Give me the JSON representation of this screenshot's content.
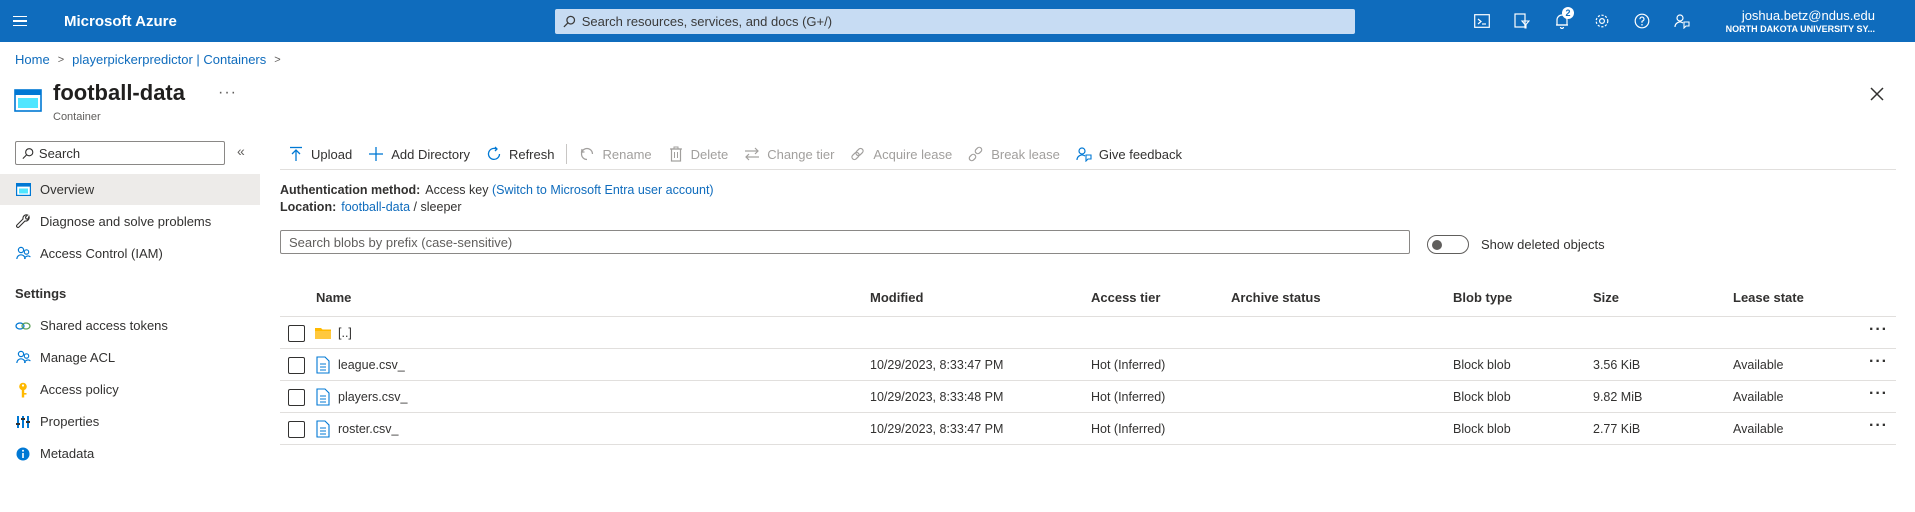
{
  "topbar": {
    "brand": "Microsoft Azure",
    "search_placeholder": "Search resources, services, and docs (G+/)",
    "notification_count": "2",
    "account_email": "joshua.betz@ndus.edu",
    "account_org": "NORTH DAKOTA UNIVERSITY SY..."
  },
  "breadcrumb": {
    "home": "Home",
    "parent": "playerpickerpredictor | Containers"
  },
  "header": {
    "title": "football-data",
    "subtitle": "Container",
    "more": "···"
  },
  "sidebar": {
    "search_placeholder": "Search",
    "collapse": "«",
    "items": [
      {
        "label": "Overview",
        "icon": "overview-icon"
      },
      {
        "label": "Diagnose and solve problems",
        "icon": "wrench-icon"
      },
      {
        "label": "Access Control (IAM)",
        "icon": "people-icon"
      }
    ],
    "settings_heading": "Settings",
    "settings_items": [
      {
        "label": "Shared access tokens",
        "icon": "link-icon"
      },
      {
        "label": "Manage ACL",
        "icon": "people-icon"
      },
      {
        "label": "Access policy",
        "icon": "key-icon"
      },
      {
        "label": "Properties",
        "icon": "sliders-icon"
      },
      {
        "label": "Metadata",
        "icon": "info-icon"
      }
    ]
  },
  "toolbar": {
    "upload": "Upload",
    "add_directory": "Add Directory",
    "refresh": "Refresh",
    "rename": "Rename",
    "delete": "Delete",
    "change_tier": "Change tier",
    "acquire_lease": "Acquire lease",
    "break_lease": "Break lease",
    "give_feedback": "Give feedback"
  },
  "info": {
    "auth_label": "Authentication method:",
    "auth_value": "Access key",
    "auth_link": "(Switch to Microsoft Entra user account)",
    "location_label": "Location:",
    "location_link": "football-data",
    "location_sep": "/",
    "location_path": "sleeper"
  },
  "blob_search": {
    "placeholder": "Search blobs by prefix (case-sensitive)"
  },
  "show_deleted": {
    "label": "Show deleted objects",
    "enabled": false
  },
  "table": {
    "columns": {
      "name": "Name",
      "modified": "Modified",
      "access_tier": "Access tier",
      "archive_status": "Archive status",
      "blob_type": "Blob type",
      "size": "Size",
      "lease_state": "Lease state"
    },
    "parent_row": {
      "name": "[..]"
    },
    "rows": [
      {
        "name": "league.csv_",
        "modified": "10/29/2023, 8:33:47 PM",
        "access_tier": "Hot (Inferred)",
        "archive_status": "",
        "blob_type": "Block blob",
        "size": "3.56 KiB",
        "lease_state": "Available"
      },
      {
        "name": "players.csv_",
        "modified": "10/29/2023, 8:33:48 PM",
        "access_tier": "Hot (Inferred)",
        "archive_status": "",
        "blob_type": "Block blob",
        "size": "9.82 MiB",
        "lease_state": "Available"
      },
      {
        "name": "roster.csv_",
        "modified": "10/29/2023, 8:33:47 PM",
        "access_tier": "Hot (Inferred)",
        "archive_status": "",
        "blob_type": "Block blob",
        "size": "2.77 KiB",
        "lease_state": "Available"
      }
    ],
    "more": "···"
  },
  "colors": {
    "topbar": "#0f6cbd",
    "link": "#0f6cbd",
    "active_nav": "#edebe9",
    "folder": "#ffb900"
  }
}
